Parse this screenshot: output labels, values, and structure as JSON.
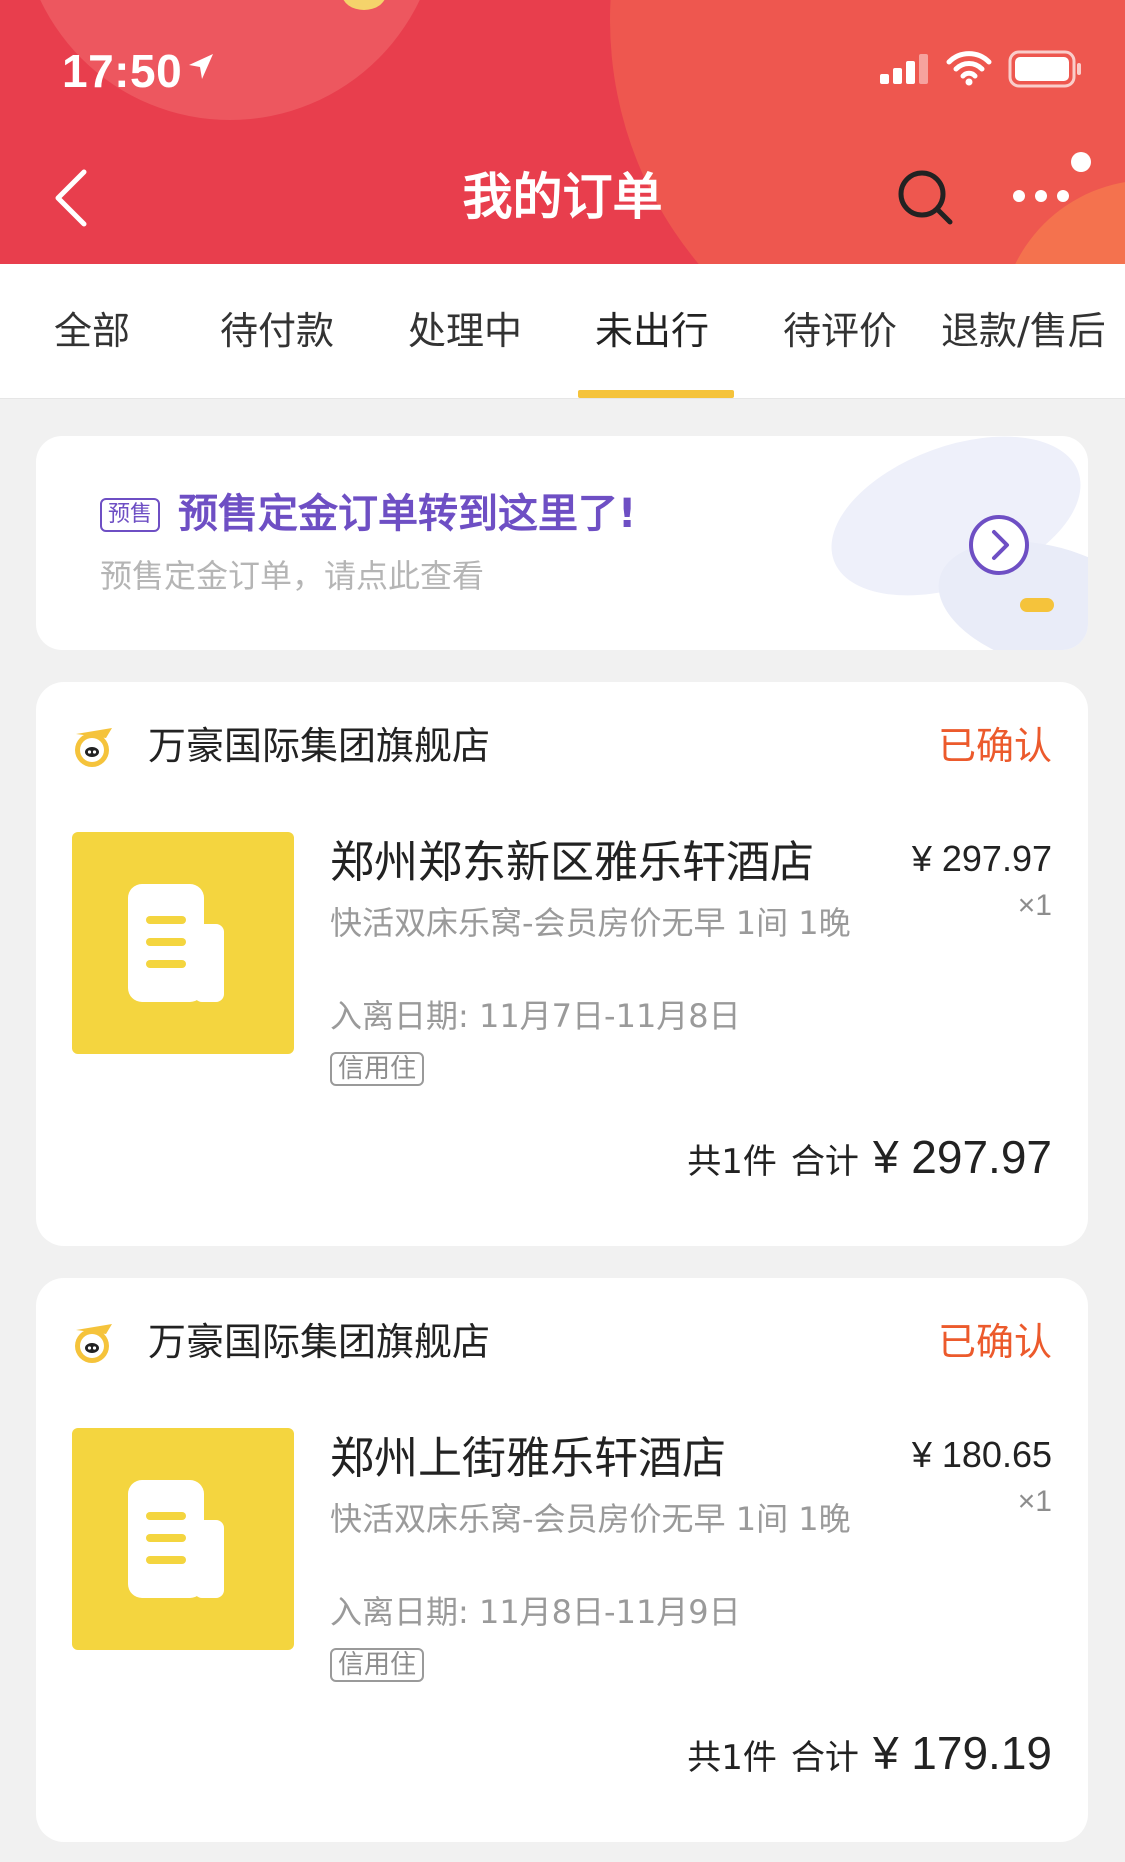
{
  "status_bar": {
    "time": "17:50"
  },
  "header": {
    "title": "我的订单"
  },
  "tabs": [
    {
      "label": "全部",
      "active": false
    },
    {
      "label": "待付款",
      "active": false
    },
    {
      "label": "处理中",
      "active": false
    },
    {
      "label": "未出行",
      "active": true
    },
    {
      "label": "待评价",
      "active": false
    },
    {
      "label": "退款/售后",
      "active": false
    }
  ],
  "banner": {
    "badge": "预售",
    "title": "预售定金订单转到这里了!",
    "subtitle": "预售定金订单，请点此查看"
  },
  "orders": [
    {
      "shop_name": "万豪国际集团旗舰店",
      "status": "已确认",
      "hotel_name": "郑州郑东新区雅乐轩酒店",
      "room_desc": "快活双床乐窝-会员房价无早 1间 1晚",
      "dates": "入离日期: 11月7日-11月8日",
      "tag": "信用住",
      "unit_price": "¥ 297.97",
      "quantity": "×1",
      "total_count": "共1件",
      "total_label": "合计",
      "total_amount": "¥ 297.97"
    },
    {
      "shop_name": "万豪国际集团旗舰店",
      "status": "已确认",
      "hotel_name": "郑州上街雅乐轩酒店",
      "room_desc": "快活双床乐窝-会员房价无早 1间 1晚",
      "dates": "入离日期: 11月8日-11月9日",
      "tag": "信用住",
      "unit_price": "¥ 180.65",
      "quantity": "×1",
      "total_count": "共1件",
      "total_label": "合计",
      "total_amount": "¥ 179.19"
    }
  ],
  "colors": {
    "header_bg": "#e83e4d",
    "tab_indicator": "#f5c33b",
    "status_text": "#ec5a2c",
    "presale_purple": "#6e4fc4",
    "thumb_yellow": "#f4d53f"
  },
  "icons": {
    "back": "chevron-left-icon",
    "search": "search-icon",
    "more": "more-dots-icon",
    "banner_arrow": "circle-chevron-right-icon",
    "shop": "fliggy-pig-icon",
    "thumb": "document-icon"
  }
}
